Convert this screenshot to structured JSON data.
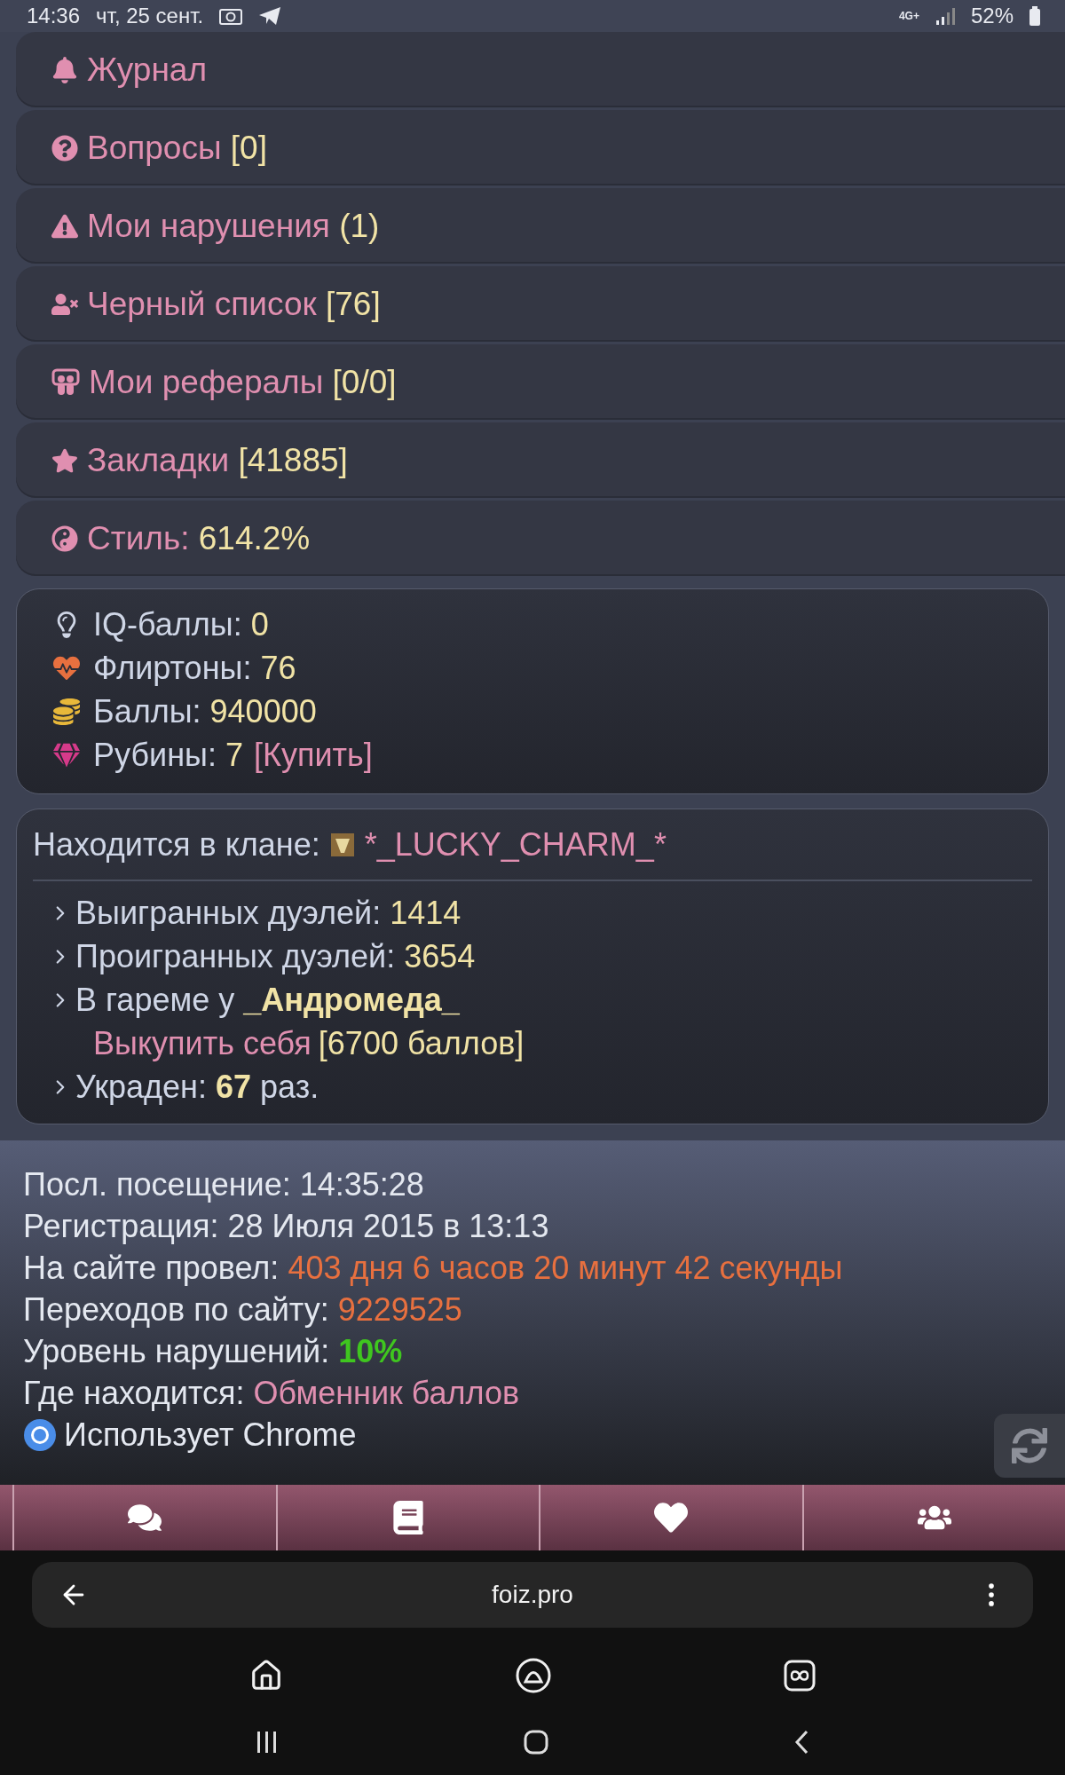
{
  "status_bar": {
    "time": "14:36",
    "date": "чт, 25 сент.",
    "network": "4G+",
    "battery": "52%"
  },
  "menu": [
    {
      "label": "Журнал"
    },
    {
      "label": "Вопросы",
      "count": "[0]"
    },
    {
      "label": "Мои нарушения",
      "count": "(1)"
    },
    {
      "label": "Черный список",
      "count": "[76]"
    },
    {
      "label": "Мои рефералы",
      "count": "[0/0]"
    },
    {
      "label": "Закладки",
      "count": "[41885]"
    },
    {
      "label": "Стиль:",
      "count": "614.2%"
    }
  ],
  "balances": [
    {
      "label": "IQ-баллы:",
      "value": "0"
    },
    {
      "label": "Флиртоны:",
      "value": "76"
    },
    {
      "label": "Баллы:",
      "value": "940000"
    },
    {
      "label": "Рубины:",
      "value": "7",
      "link": "[Купить]"
    }
  ],
  "clan": {
    "label": "Находится в клане:",
    "name": "*_LUCKY_CHARM_*",
    "stats": [
      {
        "text": "Выигранных дуэлей:",
        "value": "1414"
      },
      {
        "text": "Проигранных дуэлей:",
        "value": "3654"
      },
      {
        "text": "В гареме у **_Андромеда_**",
        "link": "Выкупить себя",
        "price": "[6700 баллов]"
      },
      {
        "text": "Украден: **67** раз."
      }
    ]
  },
  "info": [
    {
      "label": "Посл. посещение:",
      "value": "14:35:28"
    },
    {
      "label": "Регистрация:",
      "value": "28 Июля 2015 в 13:13"
    },
    {
      "label": "На сайте провел:",
      "value": "403 дня 6 часов 20 минут 42 секунды",
      "color": "#e8703f"
    },
    {
      "label": "Переходов по сайту:",
      "value": "9229525",
      "color": "#e8703f"
    },
    {
      "label": "Уровень нарушений:",
      "value": "10%",
      "color": "#3fc61f"
    },
    {
      "label": "Где находится:",
      "value": "Обменник баллов",
      "color": "#e08fb0"
    }
  ],
  "browser_note": "Использует Chrome",
  "address_bar": {
    "url": "foiz.pro"
  }
}
